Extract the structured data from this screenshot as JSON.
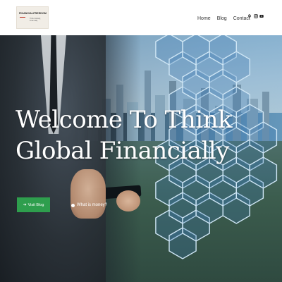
{
  "header": {
    "logo_title": "FINANCIALFREEDOM",
    "logo_subtitle": "Think Globally, Financially",
    "nav": [
      {
        "label": "Home"
      },
      {
        "label": "Blog"
      },
      {
        "label": "Contact"
      }
    ],
    "social_icons": [
      "pinterest-icon",
      "instagram-icon",
      "youtube-icon"
    ]
  },
  "hero": {
    "title_line1": "Welcome To Think",
    "title_line2": "Global Financially",
    "primary_button": "Visit Blog",
    "secondary_link": "What is money?"
  },
  "colors": {
    "accent_green": "#2e9e4d",
    "hex_stroke": "#cfe6f5",
    "hex_fill": "#3d7bb3"
  }
}
